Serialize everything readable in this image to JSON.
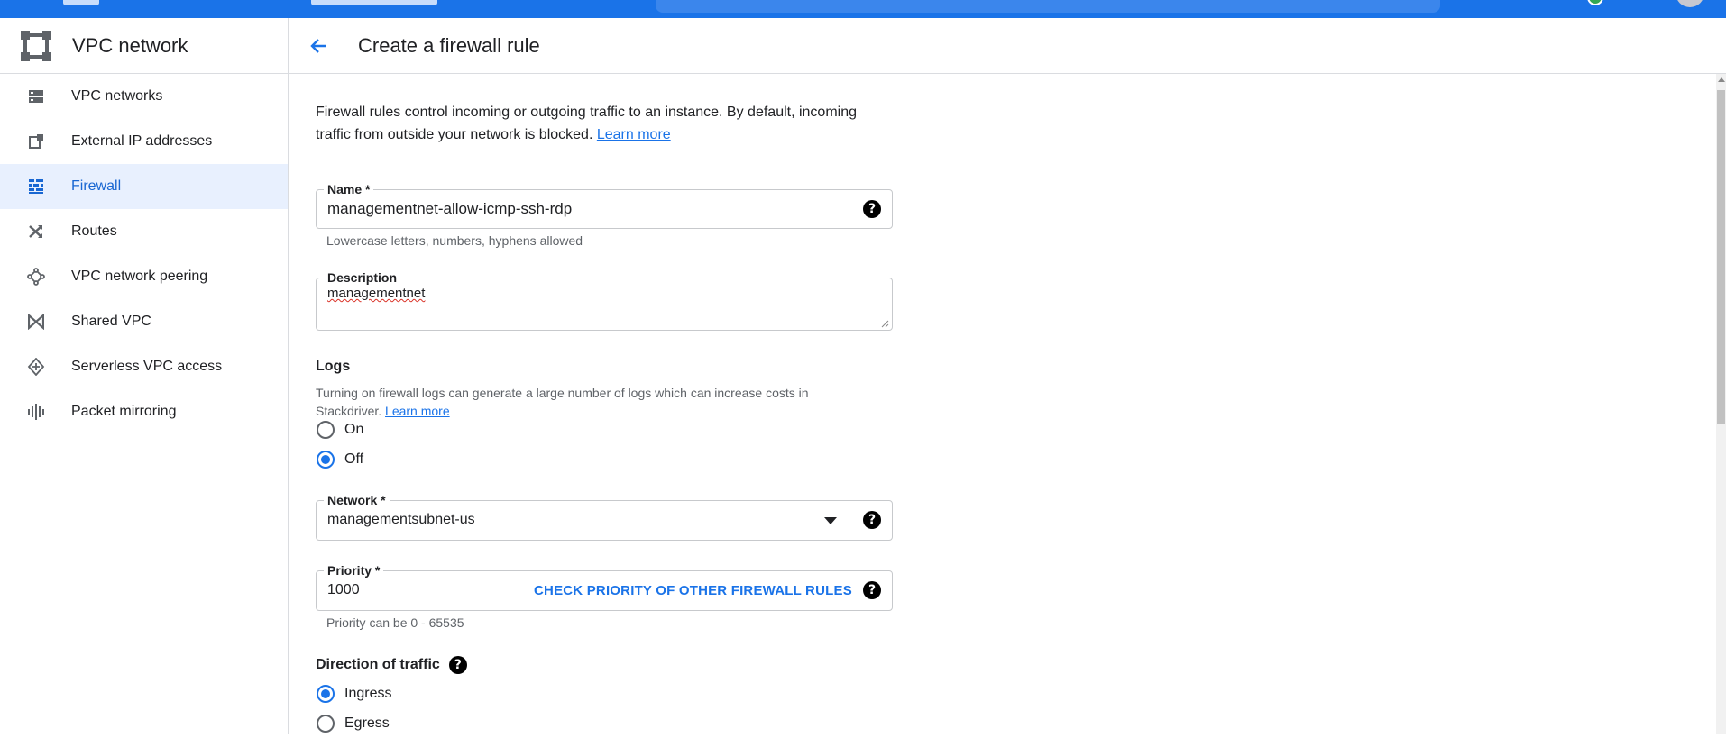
{
  "app": {
    "product_title": "VPC network",
    "page_title": "Create a firewall rule"
  },
  "sidebar": {
    "items": [
      {
        "label": "VPC networks",
        "icon": "vpc-networks-icon",
        "active": false
      },
      {
        "label": "External IP addresses",
        "icon": "external-ip-icon",
        "active": false
      },
      {
        "label": "Firewall",
        "icon": "firewall-icon",
        "active": true
      },
      {
        "label": "Routes",
        "icon": "routes-icon",
        "active": false
      },
      {
        "label": "VPC network peering",
        "icon": "peering-icon",
        "active": false
      },
      {
        "label": "Shared VPC",
        "icon": "shared-vpc-icon",
        "active": false
      },
      {
        "label": "Serverless VPC access",
        "icon": "serverless-icon",
        "active": false
      },
      {
        "label": "Packet mirroring",
        "icon": "packet-mirroring-icon",
        "active": false
      }
    ]
  },
  "form": {
    "intro_text": "Firewall rules control incoming or outgoing traffic to an instance. By default, incoming traffic from outside your network is blocked.",
    "intro_link": "Learn more",
    "name": {
      "label": "Name *",
      "value": "managementnet-allow-icmp-ssh-rdp",
      "hint": "Lowercase letters, numbers, hyphens allowed"
    },
    "description": {
      "label": "Description",
      "value": "managementnet"
    },
    "logs": {
      "title": "Logs",
      "text": "Turning on firewall logs can generate a large number of logs which can increase costs in Stackdriver.",
      "link": "Learn more",
      "options": [
        {
          "label": "On",
          "selected": false
        },
        {
          "label": "Off",
          "selected": true
        }
      ]
    },
    "network": {
      "label": "Network *",
      "value": "managementsubnet-us"
    },
    "priority": {
      "label": "Priority *",
      "value": "1000",
      "action": "CHECK PRIORITY OF OTHER FIREWALL RULES",
      "hint": "Priority can be 0 - 65535"
    },
    "direction": {
      "title": "Direction of traffic",
      "options": [
        {
          "label": "Ingress",
          "selected": true
        },
        {
          "label": "Egress",
          "selected": false
        }
      ]
    }
  },
  "colors": {
    "brand_blue": "#1a73e8",
    "active_bg": "#e8f0fe",
    "active_text": "#1967d2"
  }
}
